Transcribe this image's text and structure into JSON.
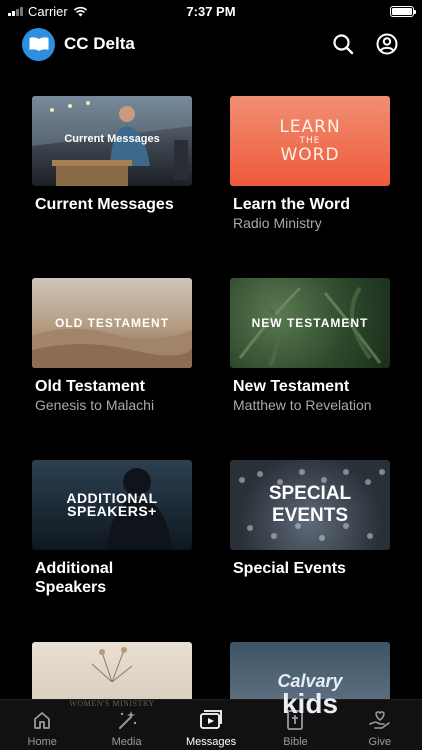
{
  "status_bar": {
    "carrier": "Carrier",
    "time": "7:37 PM"
  },
  "header": {
    "title": "CC Delta",
    "icons": [
      "search-icon",
      "account-icon"
    ]
  },
  "cards": [
    {
      "title": "Current Messages",
      "subtitle": "",
      "thumb_text": "Current Messages"
    },
    {
      "title": "Learn the Word",
      "subtitle": "Radio Ministry",
      "thumb_text_line1": "LEARN",
      "thumb_text_line2": "THE",
      "thumb_text_line3": "WORD"
    },
    {
      "title": "Old Testament",
      "subtitle": "Genesis to Malachi",
      "thumb_text": "OLD TESTAMENT"
    },
    {
      "title": "New Testament",
      "subtitle": "Matthew to Revelation",
      "thumb_text": "NEW TESTAMENT"
    },
    {
      "title_line1": "Additional",
      "title_line2": "Speakers",
      "subtitle": "",
      "thumb_text_line1": "ADDITIONAL",
      "thumb_text_line2": "SPEAKERS+"
    },
    {
      "title": "Special Events",
      "subtitle": "",
      "thumb_text": "SPECIAL EVENTS"
    },
    {
      "thumb_text": "WOMEN'S MINISTRY"
    },
    {
      "thumb_text_line1": "Calvary",
      "thumb_text_line2": "kids"
    }
  ],
  "tabs": [
    {
      "label": "Home",
      "icon": "home-icon",
      "active": false
    },
    {
      "label": "Media",
      "icon": "media-icon",
      "active": false
    },
    {
      "label": "Messages",
      "icon": "messages-icon",
      "active": true
    },
    {
      "label": "Bible",
      "icon": "bible-icon",
      "active": false
    },
    {
      "label": "Give",
      "icon": "give-icon",
      "active": false
    }
  ],
  "colors": {
    "background": "#000000",
    "accent": "#2e8fe0",
    "subtitle": "#a9a9a9",
    "tab_bar": "#111111"
  }
}
